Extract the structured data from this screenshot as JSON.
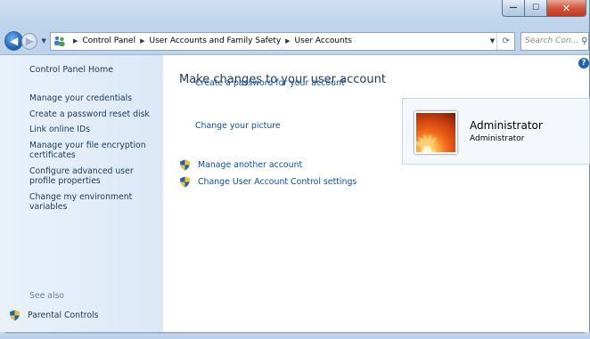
{
  "window": {
    "caption": {
      "minimize": "—",
      "maximize": "☐",
      "close": "✕"
    }
  },
  "nav": {
    "back_icon": "back-arrow-icon",
    "forward_icon": "forward-arrow-icon",
    "breadcrumbs": [
      "Control Panel",
      "User Accounts and Family Safety",
      "User Accounts"
    ],
    "search_placeholder": "Search Con..."
  },
  "sidebar": {
    "home": "Control Panel Home",
    "links": [
      "Manage your credentials",
      "Create a password reset disk",
      "Link online IDs",
      "Manage your file encryption certificates",
      "Configure advanced user profile properties",
      "Change my environment variables"
    ],
    "see_also_label": "See also",
    "parental_controls": "Parental Controls"
  },
  "main": {
    "heading": "Make changes to your user account",
    "links": {
      "create_password": "Create a password for your account",
      "change_picture": "Change your picture",
      "manage_another": "Manage another account",
      "uac_settings": "Change User Account Control settings"
    },
    "user": {
      "name": "Administrator",
      "type": "Administrator"
    }
  },
  "colors": {
    "link": "#0b4fb5",
    "heading": "#1e395b",
    "sidebar_bg": "#e9f2fb",
    "close_red": "#d2553f"
  }
}
